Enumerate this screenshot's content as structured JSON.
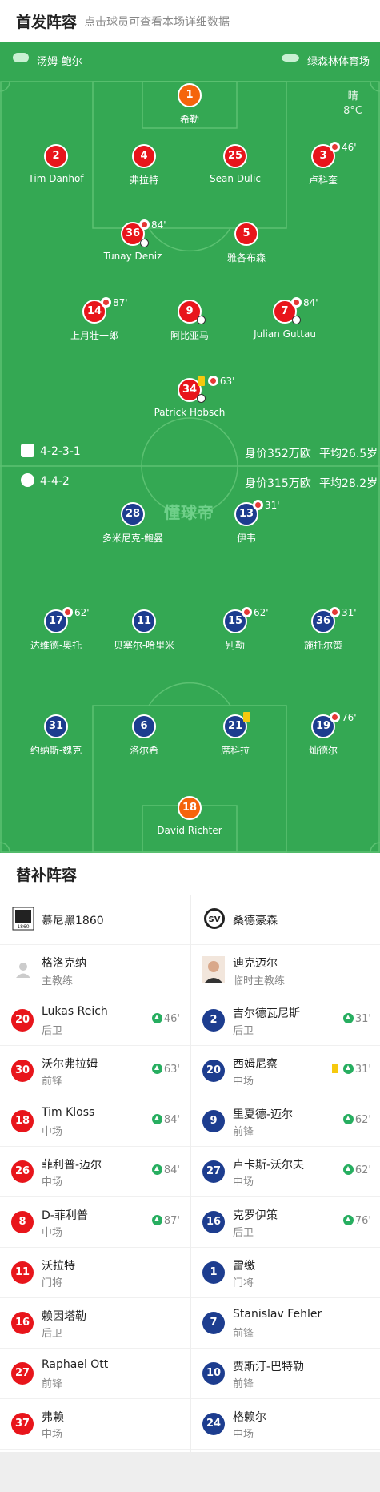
{
  "header": {
    "title": "首发阵容",
    "subtitle": "点击球员可查看本场详细数据"
  },
  "match": {
    "referee": "汤姆-鲍尔",
    "stadium": "绿森林体育场",
    "weather": "晴",
    "temperature": "8°C"
  },
  "home": {
    "formation": "4-2-3-1",
    "value": "身价352万欧",
    "age": "平均26.5岁",
    "players": [
      {
        "num": "1",
        "name": "希勒",
        "color": "orange"
      },
      {
        "num": "2",
        "name": "Tim Danhof",
        "color": "red"
      },
      {
        "num": "4",
        "name": "弗拉特",
        "color": "red"
      },
      {
        "num": "25",
        "name": "Sean Dulic",
        "color": "red"
      },
      {
        "num": "3",
        "name": "卢科奎",
        "color": "red",
        "sub": "46'"
      },
      {
        "num": "36",
        "name": "Tunay Deniz",
        "color": "red",
        "sub": "84'"
      },
      {
        "num": "5",
        "name": "雅各布森",
        "color": "red"
      },
      {
        "num": "14",
        "name": "上月壮一郎",
        "color": "red",
        "sub": "87'"
      },
      {
        "num": "9",
        "name": "阿比亚马",
        "color": "red"
      },
      {
        "num": "7",
        "name": "Julian Guttau",
        "color": "red",
        "sub": "84'"
      },
      {
        "num": "34",
        "name": "Patrick Hobsch",
        "color": "red",
        "sub": "63'"
      }
    ]
  },
  "away": {
    "formation": "4-4-2",
    "value": "身价315万欧",
    "age": "平均28.2岁",
    "players": [
      {
        "num": "28",
        "name": "多米尼克-鲍曼",
        "color": "blue"
      },
      {
        "num": "13",
        "name": "伊韦",
        "color": "blue",
        "sub": "31'"
      },
      {
        "num": "17",
        "name": "达维德-奥托",
        "color": "blue",
        "sub": "62'"
      },
      {
        "num": "11",
        "name": "贝塞尔-哈里米",
        "color": "blue"
      },
      {
        "num": "15",
        "name": "别勒",
        "color": "blue",
        "sub": "62'"
      },
      {
        "num": "36",
        "name": "施托尔策",
        "color": "blue",
        "sub": "31'"
      },
      {
        "num": "31",
        "name": "约纳斯-魏克",
        "color": "blue"
      },
      {
        "num": "6",
        "name": "洛尔希",
        "color": "blue"
      },
      {
        "num": "21",
        "name": "席科拉",
        "color": "blue"
      },
      {
        "num": "19",
        "name": "灿德尔",
        "color": "blue",
        "sub": "76'"
      },
      {
        "num": "18",
        "name": "David Richter",
        "color": "orange"
      }
    ]
  },
  "watermark": "懂球帝",
  "bench": {
    "title": "替补阵容",
    "home": {
      "team": "慕尼黑1860",
      "coach": "格洛克纳",
      "coach_role": "主教练",
      "players": [
        {
          "num": "20",
          "name": "Lukas Reich",
          "pos": "后卫",
          "sub": "46'"
        },
        {
          "num": "30",
          "name": "沃尔弗拉姆",
          "pos": "前锋",
          "sub": "63'"
        },
        {
          "num": "18",
          "name": "Tim Kloss",
          "pos": "中场",
          "sub": "84'"
        },
        {
          "num": "26",
          "name": "菲利普-迈尔",
          "pos": "中场",
          "sub": "84'"
        },
        {
          "num": "8",
          "name": "D-菲利普",
          "pos": "中场",
          "sub": "87'"
        },
        {
          "num": "11",
          "name": "沃拉特",
          "pos": "门将",
          "sub": ""
        },
        {
          "num": "16",
          "name": "赖因塔勒",
          "pos": "后卫",
          "sub": ""
        },
        {
          "num": "27",
          "name": "Raphael Ott",
          "pos": "前锋",
          "sub": ""
        },
        {
          "num": "37",
          "name": "弗赖",
          "pos": "中场",
          "sub": ""
        }
      ]
    },
    "away": {
      "team": "桑德豪森",
      "coach": "迪克迈尔",
      "coach_role": "临时主教练",
      "players": [
        {
          "num": "2",
          "name": "吉尔德瓦尼斯",
          "pos": "后卫",
          "sub": "31'"
        },
        {
          "num": "20",
          "name": "西姆尼察",
          "pos": "中场",
          "sub": "31'"
        },
        {
          "num": "9",
          "name": "里夏德-迈尔",
          "pos": "前锋",
          "sub": "62'"
        },
        {
          "num": "27",
          "name": "卢卡斯-沃尔夫",
          "pos": "中场",
          "sub": "62'"
        },
        {
          "num": "16",
          "name": "克罗伊策",
          "pos": "后卫",
          "sub": "76'"
        },
        {
          "num": "1",
          "name": "雷缴",
          "pos": "门将",
          "sub": ""
        },
        {
          "num": "7",
          "name": "Stanislav Fehler",
          "pos": "前锋",
          "sub": ""
        },
        {
          "num": "10",
          "name": "贾斯汀-巴特勒",
          "pos": "前锋",
          "sub": ""
        },
        {
          "num": "24",
          "name": "格赖尔",
          "pos": "中场",
          "sub": ""
        }
      ]
    }
  }
}
